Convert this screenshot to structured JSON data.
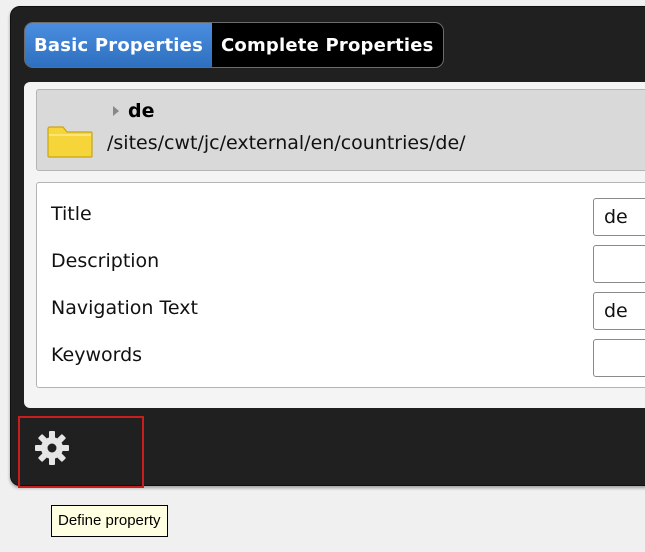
{
  "tabs": [
    {
      "label": "Basic Properties",
      "active": true
    },
    {
      "label": "Complete Properties",
      "active": false
    }
  ],
  "node": {
    "name": "de",
    "path": "/sites/cwt/jc/external/en/countries/de/"
  },
  "fields": [
    {
      "label": "Title",
      "value": "de"
    },
    {
      "label": "Description",
      "value": ""
    },
    {
      "label": "Navigation Text",
      "value": "de"
    },
    {
      "label": "Keywords",
      "value": ""
    }
  ],
  "toolbar": {
    "icon": "gear-icon"
  },
  "tooltip": {
    "text": "Define property"
  },
  "colors": {
    "accent": "#3a80d0",
    "highlight": "#c81e1e",
    "panel": "#202020"
  }
}
